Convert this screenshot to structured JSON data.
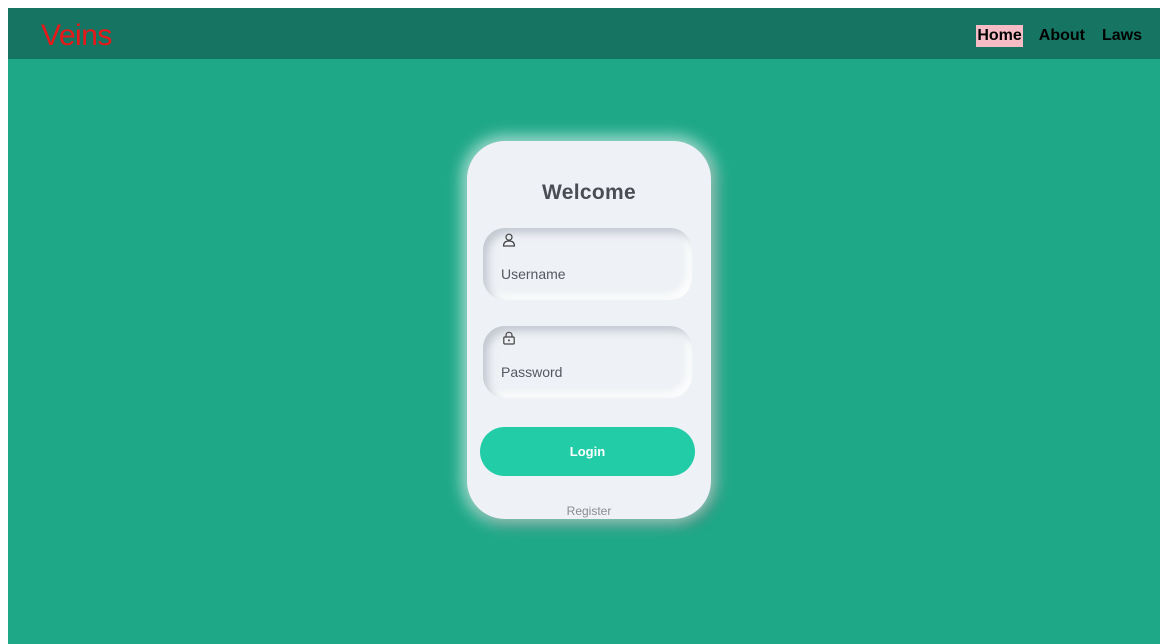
{
  "navbar": {
    "brand": "Veins",
    "links": [
      {
        "label": "Home",
        "active": true
      },
      {
        "label": "About",
        "active": false
      },
      {
        "label": "Laws",
        "active": false
      }
    ]
  },
  "login": {
    "title": "Welcome",
    "username": {
      "placeholder": "Username",
      "icon": "user-icon"
    },
    "password": {
      "placeholder": "Password",
      "icon": "lock-icon"
    },
    "submit_label": "Login",
    "register_label": "Register"
  },
  "colors": {
    "background": "#1fa888",
    "navbar": "#167463",
    "brand": "#e81818",
    "active_link_bg": "#f6bcc6",
    "card": "#eef1f5",
    "button": "#22cca7"
  }
}
